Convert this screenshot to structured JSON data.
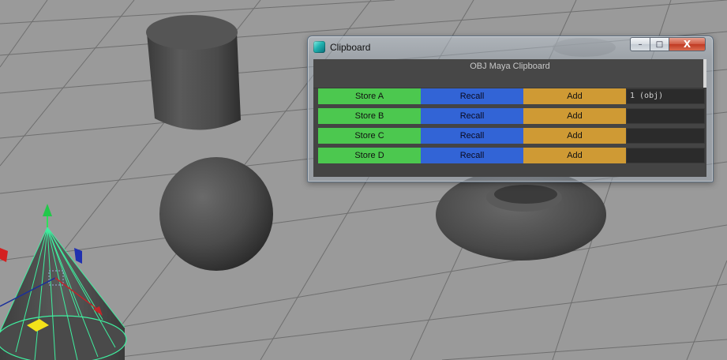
{
  "window": {
    "title": "Clipboard",
    "controls": {
      "minimize": "–",
      "maximize": "□",
      "close": "X"
    }
  },
  "panel": {
    "header": "OBJ Maya Clipboard",
    "rows": [
      {
        "store": "Store A",
        "recall": "Recall",
        "add": "Add",
        "value": "1 (obj)"
      },
      {
        "store": "Store B",
        "recall": "Recall",
        "add": "Add",
        "value": ""
      },
      {
        "store": "Store C",
        "recall": "Recall",
        "add": "Add",
        "value": ""
      },
      {
        "store": "Store D",
        "recall": "Recall",
        "add": "Add",
        "value": ""
      }
    ]
  },
  "colors": {
    "store": "#4cc84f",
    "recall": "#3264d6",
    "add": "#cf9a34",
    "viewport_bg": "#9a9a9a"
  },
  "icons": {
    "app": "maya-icon",
    "minimize": "minimize-icon",
    "maximize": "maximize-icon",
    "close": "close-icon"
  }
}
